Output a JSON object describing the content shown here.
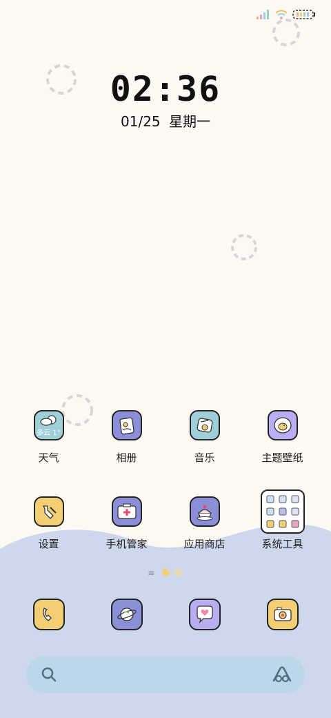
{
  "clock": {
    "time": "02:36"
  },
  "date": {
    "day": "01/25",
    "weekday": "星期一"
  },
  "weather_widget": {
    "text": "多云 1°"
  },
  "apps_row1": [
    {
      "label": "天气",
      "icon": "weather-icon"
    },
    {
      "label": "相册",
      "icon": "gallery-icon"
    },
    {
      "label": "音乐",
      "icon": "music-icon"
    },
    {
      "label": "主题壁纸",
      "icon": "theme-icon"
    }
  ],
  "apps_row2": [
    {
      "label": "设置",
      "icon": "settings-icon"
    },
    {
      "label": "手机管家",
      "icon": "phone-manager-icon"
    },
    {
      "label": "应用商店",
      "icon": "app-store-icon"
    },
    {
      "label": "系统工具",
      "icon": "system-tools-folder-icon"
    }
  ],
  "page_indicator": {
    "symbol": "≡"
  },
  "dock": [
    {
      "icon": "phone-icon"
    },
    {
      "icon": "browser-planet-icon"
    },
    {
      "icon": "messages-heart-icon"
    },
    {
      "icon": "camera-icon"
    }
  ],
  "search_bar": {
    "left_icon": "search-icon",
    "right_icon": "assistant-icon"
  },
  "colors": {
    "background": "#fbf9f2",
    "wave": "#cdd8ec",
    "teal": "#9fd0d8",
    "indigo": "#8a8fd8",
    "lavender": "#b9aef0",
    "yellow": "#f2cf72",
    "search": "#bcd6ea"
  }
}
